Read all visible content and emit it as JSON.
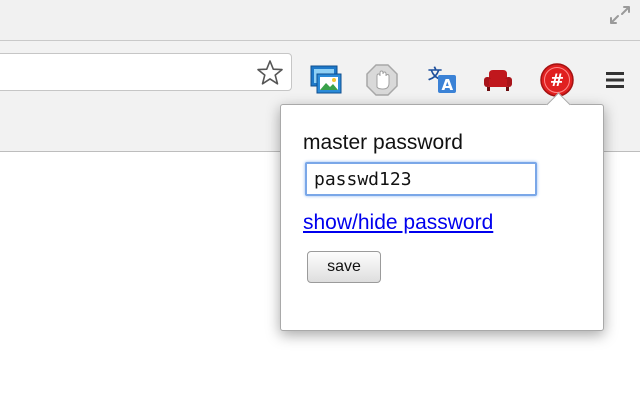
{
  "toolbar": {
    "icons": {
      "restore": "restore-arrows-icon",
      "bookmark": "star-outline-icon",
      "image_ext": "image-extension-icon",
      "stop_ext": "stop-hand-icon",
      "translate_ext": "translate-icon",
      "sofa_ext": "sofa-icon",
      "hash_ext": "hash-badge-icon",
      "menu": "hamburger-menu-icon"
    }
  },
  "popup": {
    "label": "master password",
    "password_value": "passwd123",
    "toggle_link": "show/hide password",
    "save_label": "save"
  },
  "colors": {
    "link": "#0000ee",
    "focus_ring": "#7aa7e8",
    "hash_badge": "#e02020",
    "sofa": "#c0171d",
    "image_ext": "#1e78c8"
  }
}
